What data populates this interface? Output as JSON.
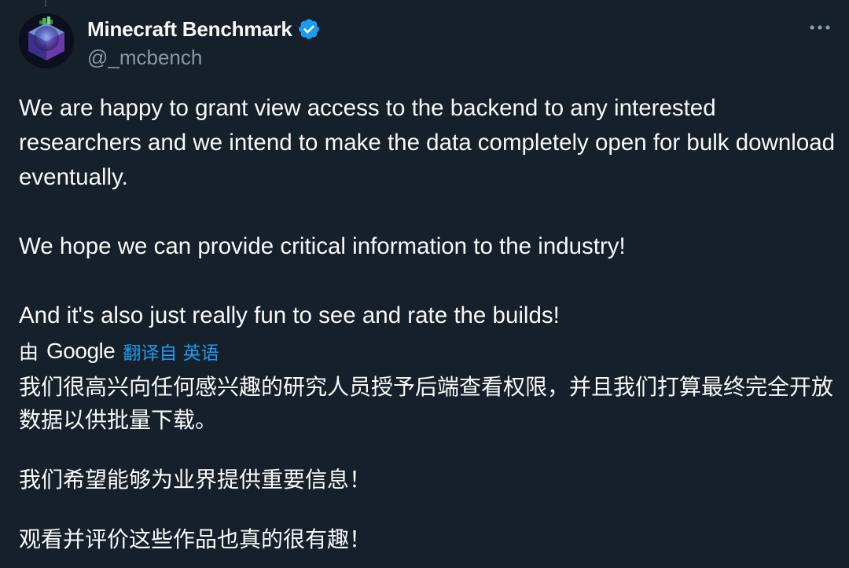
{
  "tweet": {
    "author": {
      "display_name": "Minecraft Benchmark",
      "handle": "@_mcbench",
      "verified": true,
      "verified_icon": "verified-badge-icon",
      "verified_color": "#1d9bf0",
      "avatar_icon": "minecraft-block-avatar"
    },
    "more_icon": "more-horizontal-icon",
    "text": [
      "We are happy to grant view access to the backend to any interested researchers and we intend to make the data completely open for bulk download eventually.",
      "We hope we can provide critical information to the industry!",
      "And it's also just really fun to see and rate the builds!"
    ],
    "translation": {
      "by_label": "由",
      "provider": "Google",
      "action_label": "翻译自 英语",
      "text": [
        "我们很高兴向任何感兴趣的研究人员授予后端查看权限，并且我们打算最终完全开放数据以供批量下载。",
        "我们希望能够为业界提供重要信息！",
        "观看并评价这些作品也真的很有趣！"
      ]
    }
  },
  "colors": {
    "background": "#15202b",
    "text_primary": "#f7f9f9",
    "text_secondary": "#8b98a5",
    "accent": "#1d9bf0"
  }
}
